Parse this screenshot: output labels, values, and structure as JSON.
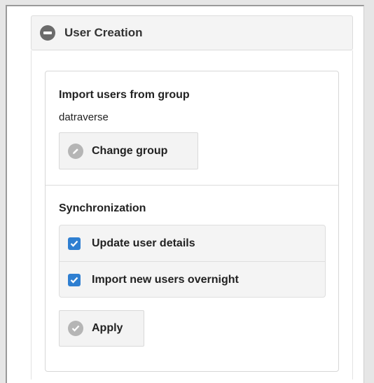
{
  "panel": {
    "title": "User Creation",
    "collapse_icon": "minus-circle-icon"
  },
  "import_section": {
    "heading": "Import users from group",
    "group_name": "datraverse",
    "change_button": {
      "label": "Change group",
      "icon": "pencil-icon"
    }
  },
  "sync_section": {
    "heading": "Synchronization",
    "options": [
      {
        "label": "Update user details",
        "checked": true
      },
      {
        "label": "Import new users overnight",
        "checked": true
      }
    ],
    "apply_button": {
      "label": "Apply",
      "icon": "checkmark-icon"
    }
  },
  "colors": {
    "checkbox": "#2f7fd1",
    "panel_header_bg": "#f4f4f4",
    "button_bg": "#f3f3f3"
  }
}
